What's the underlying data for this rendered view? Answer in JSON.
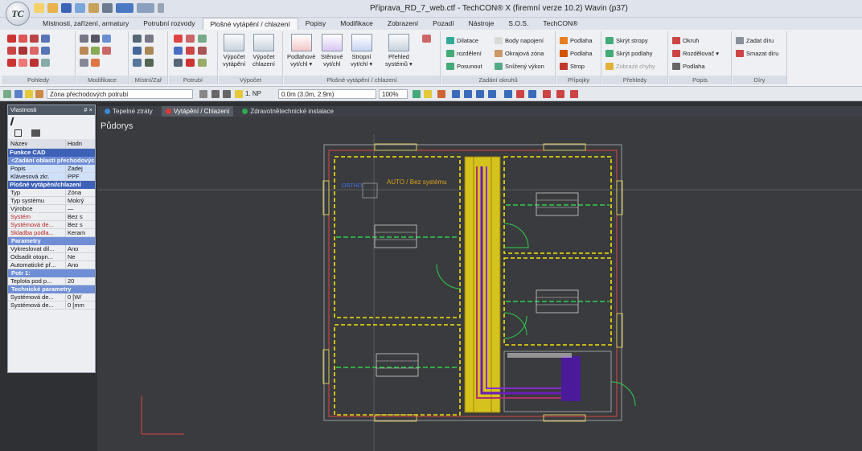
{
  "window": {
    "title": "Příprava_RD_7_web.ctf - TechCON® X  (firemní verze 10.2) Wavin  (p37)",
    "logo": "TC"
  },
  "ribbon_tabs": [
    "Místnosti, zařízení, armatury",
    "Potrubní rozvody",
    "Plošné vytápění / chlazení",
    "Popisy",
    "Modifikace",
    "Zobrazení",
    "Pozadí",
    "Nástroje",
    "S.O.S.",
    "TechCON®"
  ],
  "active_tab_index": 2,
  "ribbon_groups": {
    "pohledy": "Pohledy",
    "modifikace": "Modifikace",
    "mistni": "Místní/Zař",
    "potrubi": "Potrubí",
    "vypocet": {
      "label": "Výpočet",
      "btn1": [
        "Výpočet",
        "vytápění"
      ],
      "btn2": [
        "Výpočet",
        "chlazení"
      ]
    },
    "plosne": {
      "label": "Plošné vytápění / chlazení",
      "btns": [
        [
          "Podlahové",
          "vyt/chl ▾"
        ],
        [
          "Stěnové",
          "vyt/chl"
        ],
        [
          "Stropní",
          "vyt/chl ▾"
        ],
        [
          "Přehled",
          "systémů ▾"
        ]
      ]
    },
    "zadani": {
      "label": "Zadání okruhů",
      "items": [
        "Dilatace",
        "Body napojení",
        "rozdělení",
        "Okrajová zóna",
        "Posunout",
        "Snížený výkon"
      ]
    },
    "pripojky": {
      "label": "Přípojky",
      "items": [
        "Podlaha",
        "Podlaha",
        "Strop"
      ]
    },
    "prehledy": {
      "label": "Přehledy",
      "items": [
        "Skrýt stropy",
        "Skrýt podlahy",
        "Zobrazit chyby"
      ]
    },
    "popis": {
      "label": "Popis",
      "items": [
        "Okruh",
        "Rozdělovač ▾",
        "Podlaha"
      ]
    },
    "diry": {
      "label": "Díry",
      "items": [
        "Zadat díru",
        "Smazat díru"
      ]
    }
  },
  "toolbar": {
    "zone_select": "Zóna přechodových potrubí",
    "floor": "1. NP",
    "height": "0.0m (3.0m, 2.9m)",
    "zoom": "100%"
  },
  "properties": {
    "title": "Vlastnosti",
    "controls": "# ×",
    "col_name": "Název",
    "col_value": "Hodn",
    "rows": [
      {
        "type": "cat",
        "k": "Funkce CAD"
      },
      {
        "type": "sub",
        "k": "<Zadání oblasti přechodových potrubí>"
      },
      {
        "k": "Popis",
        "v": "Zadej",
        "hl": true
      },
      {
        "k": "Klávesová zkr.",
        "v": "PPF",
        "hl": true
      },
      {
        "type": "cat",
        "k": "Plošné vytápění/chlazení"
      },
      {
        "k": "Typ",
        "v": "Zóna"
      },
      {
        "k": "Typ systému",
        "v": "Mokrý"
      },
      {
        "k": "Výrobce",
        "v": "—"
      },
      {
        "k": "Systém",
        "v": "Bez s",
        "red": true
      },
      {
        "k": "Systémová de...",
        "v": "Bez s",
        "red": true
      },
      {
        "k": "Skladba podla...",
        "v": "Keram",
        "red": true
      },
      {
        "type": "sub",
        "k": "Parametry"
      },
      {
        "k": "Vykreslovat dil...",
        "v": "Ano"
      },
      {
        "k": "Odsadit otopn...",
        "v": "Ne"
      },
      {
        "k": "Automatické př...",
        "v": "Ano"
      },
      {
        "type": "sub",
        "k": "Potr 1:"
      },
      {
        "k": "Teplota pod p...",
        "v": "20"
      },
      {
        "type": "sub",
        "k": "Technické parametry"
      },
      {
        "k": "Systémová de...",
        "v": "0 [W/"
      },
      {
        "k": "Systémová de...",
        "v": "0 [mm"
      }
    ]
  },
  "doc_tabs": [
    {
      "label": "Tepelné ztráty",
      "color": "#3b8ad9"
    },
    {
      "label": "Vytápění / Chlazení",
      "color": "#d93b3b"
    },
    {
      "label": "Zdravotnětechnické instalace",
      "color": "#2fa84f"
    }
  ],
  "active_doc_tab": 1,
  "view": {
    "label": "Půdorys",
    "annot_ortho": "ORTHO",
    "annot_auto": "AUTO / Bez systému"
  },
  "colors": {
    "ribbon_bg": "#eef0f3",
    "canvas_bg": "#3a3b3e",
    "wall_red": "#d44",
    "zone_yellow": "#f1e20a",
    "floor_green": "#2bd14d",
    "pipe_purple": "#6a1bb8"
  }
}
